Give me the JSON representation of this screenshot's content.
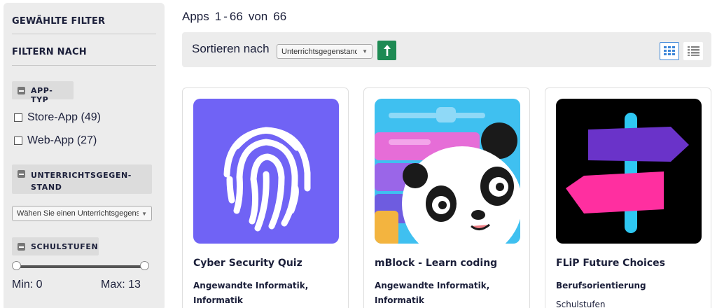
{
  "sidebar": {
    "selected_filters_heading": "GEWÄHLTE FILTER",
    "filter_by_heading": "FILTERN NACH",
    "app_type": {
      "label": "APP-TYP",
      "options": [
        {
          "label": "Store-App (49)",
          "checked": false
        },
        {
          "label": "Web-App (27)",
          "checked": false
        }
      ]
    },
    "subject": {
      "label_line1": "UNTERRICHTSGEGEN-",
      "label_line2": "STAND",
      "select_value": "Wähen Sie einen Unterrichtsgegenstand"
    },
    "school_level": {
      "label": "SCHULSTUFEN",
      "min_label": "Min: 0",
      "max_label": "Max: 13",
      "min": 0,
      "max": 13
    }
  },
  "main": {
    "count": {
      "prefix": "Apps",
      "from": "1",
      "separator": "-",
      "to": "66",
      "of": "von",
      "total": "66"
    },
    "sort": {
      "label": "Sortieren nach",
      "select_value": "Unterrichtsgegenstand"
    },
    "cards": [
      {
        "title": "Cyber Security Quiz",
        "subject": "Angewandte Informatik, Informatik",
        "meta": ""
      },
      {
        "title": "mBlock - Learn coding",
        "subject": "Angewandte Informatik, Informatik",
        "meta": ""
      },
      {
        "title": "FLiP Future Choices",
        "subject": "Berufsorientierung",
        "meta": "Schulstufen"
      }
    ]
  },
  "colors": {
    "sidebar_bg": "#ececec",
    "sort_button": "#1d8a53",
    "grid_active_border": "#3c86d8",
    "fingerprint_bg": "#7063f5",
    "signpost_bg": "#000000"
  }
}
